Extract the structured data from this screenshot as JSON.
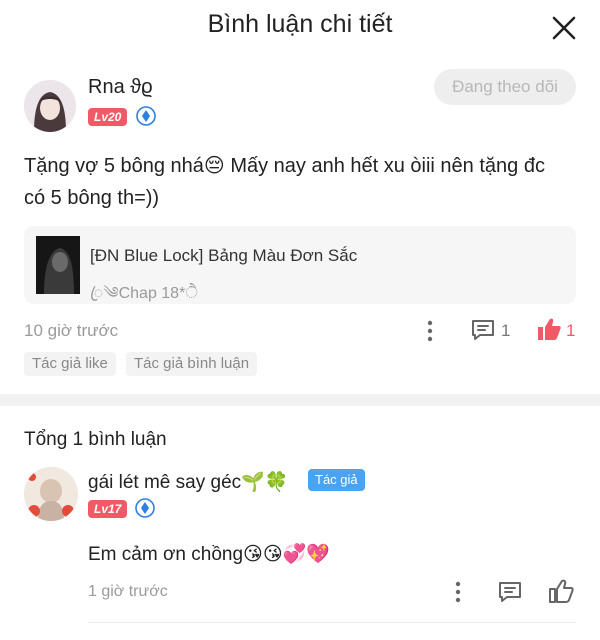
{
  "header": {
    "title": "Bình luận chi tiết",
    "close_icon": "close-icon"
  },
  "post": {
    "username": "Rna ϑϱ",
    "level": "Lv20",
    "follow_label": "Đang theo dõi",
    "text": "Tặng vợ 5 bông nhá😔 Mấy nay anh hết xu òiii nên tặng đc có 5 bông th=))",
    "chapter": {
      "title": "[ĐN Blue Lock] Bảng Màu Đơn Sắc",
      "subtitle": "ꦿ༄Chap 18*ੈ"
    },
    "time": "10 giờ trước",
    "comment_count": "1",
    "like_count": "1",
    "tags": [
      "Tác giả like",
      "Tác giả bình luận"
    ]
  },
  "comments": {
    "total_label": "Tổng 1 bình luận",
    "items": [
      {
        "name": "gái lét mê say géc🌱🍀",
        "author_badge": "Tác giả",
        "level": "Lv17",
        "text": "Em cảm ơn chồng😘😘💞💖",
        "time": "1 giờ trước"
      }
    ]
  },
  "colors": {
    "accent": "#f05a66",
    "author_badge": "#4aa3f0",
    "verify": "#2f7fe0",
    "muted": "#9a9a9a"
  }
}
